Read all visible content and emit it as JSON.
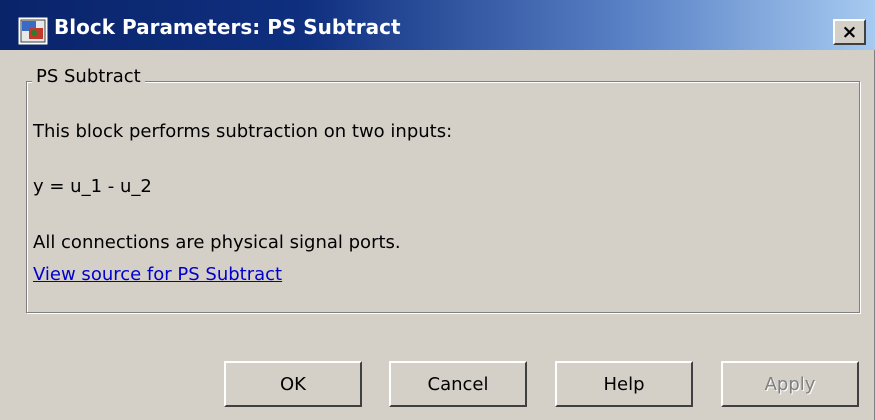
{
  "window": {
    "title": "Block Parameters: PS Subtract",
    "close_label": "×"
  },
  "group": {
    "legend": "PS Subtract",
    "description": "This block performs subtraction on two inputs:",
    "equation": "y = u_1 - u_2",
    "connections_note": "All connections are physical signal ports.",
    "source_link": "View source for PS Subtract"
  },
  "buttons": {
    "ok": "OK",
    "cancel": "Cancel",
    "help": "Help",
    "apply": "Apply"
  },
  "colors": {
    "titlebar_start": "#0a246a",
    "titlebar_end": "#a6caf0",
    "dialog_background": "#d4d0c8",
    "link": "#0000cc",
    "disabled_text": "#808080"
  },
  "state": {
    "apply_enabled": false
  }
}
